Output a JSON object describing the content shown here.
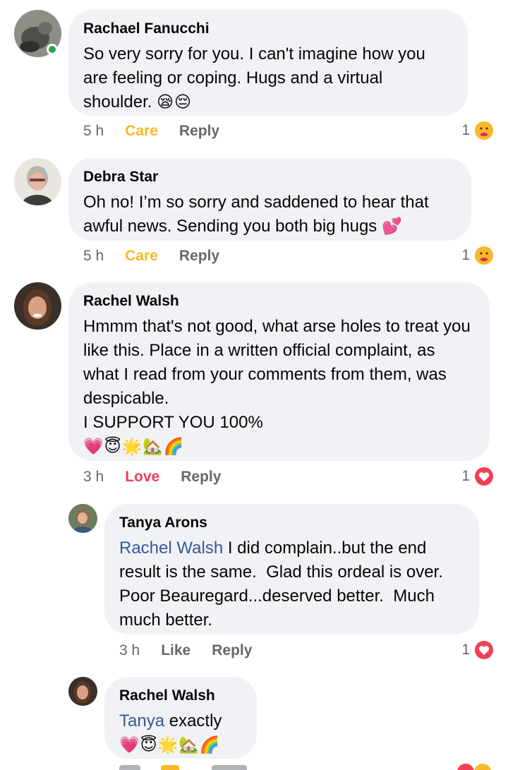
{
  "comments": [
    {
      "author": "Rachael Fanucchi",
      "text": "So very sorry for you. I can't imagine how you are feeling or coping. Hugs and a virtual shoulder. ",
      "emoji": "😪😔",
      "time": "5 h",
      "reaction_label": "Care",
      "reply_label": "Reply",
      "reaction_count": "1",
      "reaction_icon": "care-icon",
      "online": true
    },
    {
      "author": "Debra Star",
      "text": "Oh no! I’m so sorry and saddened to hear that awful news. Sending you both big hugs ",
      "emoji": "💕",
      "time": "5 h",
      "reaction_label": "Care",
      "reply_label": "Reply",
      "reaction_count": "1",
      "reaction_icon": "care-icon"
    },
    {
      "author": "Rachel Walsh",
      "text": "Hmmm that's not good, what arse holes to treat you like this. Place in a written official complaint, as what I read from your comments from them, was despicable.\nI SUPPORT YOU 100%",
      "emoji": "💗😇🌟🏡🌈",
      "time": "3 h",
      "reaction_label": "Love",
      "reply_label": "Reply",
      "reaction_count": "1",
      "reaction_icon": "love-icon"
    }
  ],
  "replies": [
    {
      "author": "Tanya Arons",
      "mention": "Rachel Walsh",
      "text": " I did complain..but the end result is the same.  Glad this ordeal is over.  Poor Beauregard...deserved better.  Much much better.",
      "time": "3 h",
      "reaction_label": "Like",
      "reply_label": "Reply",
      "reaction_count": "1",
      "reaction_icon": "love-icon"
    },
    {
      "author": "Rachel Walsh",
      "mention": "Tanya",
      "text": " exactly",
      "emoji": "💗😇🌟🏡🌈"
    }
  ],
  "colors": {
    "bubble": "#f0f2f5",
    "meta": "#65676b",
    "care": "#f7b928",
    "love": "#f33e58",
    "mention": "#385898",
    "online": "#31a24c"
  }
}
